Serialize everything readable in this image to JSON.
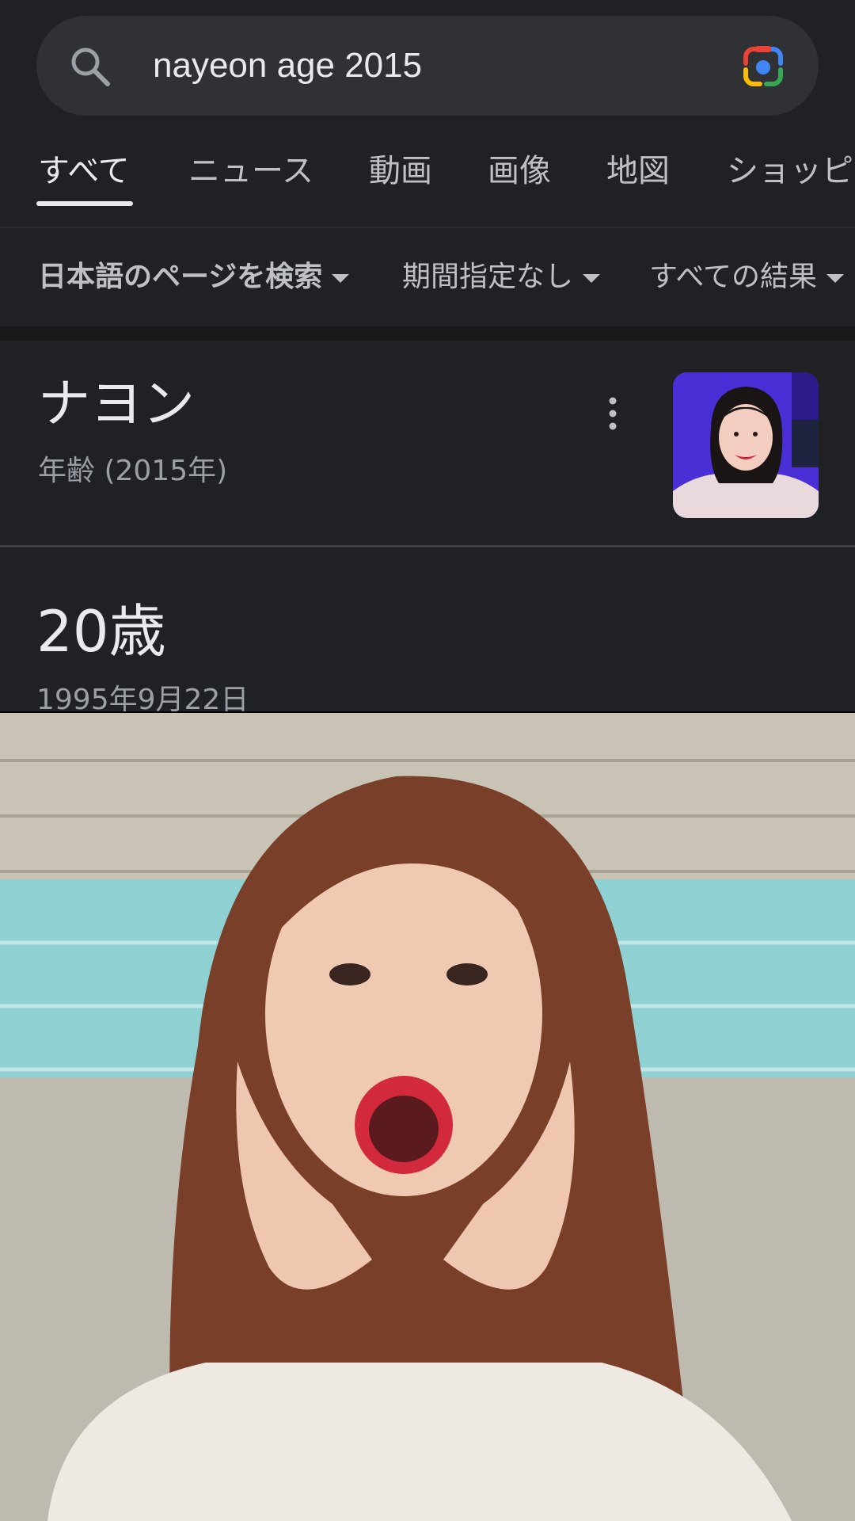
{
  "search": {
    "query": "nayeon age 2015"
  },
  "tabs": [
    {
      "label": "すべて",
      "active": true
    },
    {
      "label": "ニュース"
    },
    {
      "label": "動画"
    },
    {
      "label": "画像"
    },
    {
      "label": "地図"
    },
    {
      "label": "ショッピ"
    }
  ],
  "filters": [
    {
      "label": "日本語のページを検索"
    },
    {
      "label": "期間指定なし"
    },
    {
      "label": "すべての結果"
    }
  ],
  "knowledge_panel": {
    "title": "ナヨン",
    "subtitle": "年齢 (2015年)",
    "answer": "20歳",
    "birth_date": "1995年9月22日"
  },
  "colors": {
    "background": "#202124",
    "search_bar": "#303134",
    "text_primary": "#e8eaed",
    "text_secondary": "#9aa0a6"
  }
}
